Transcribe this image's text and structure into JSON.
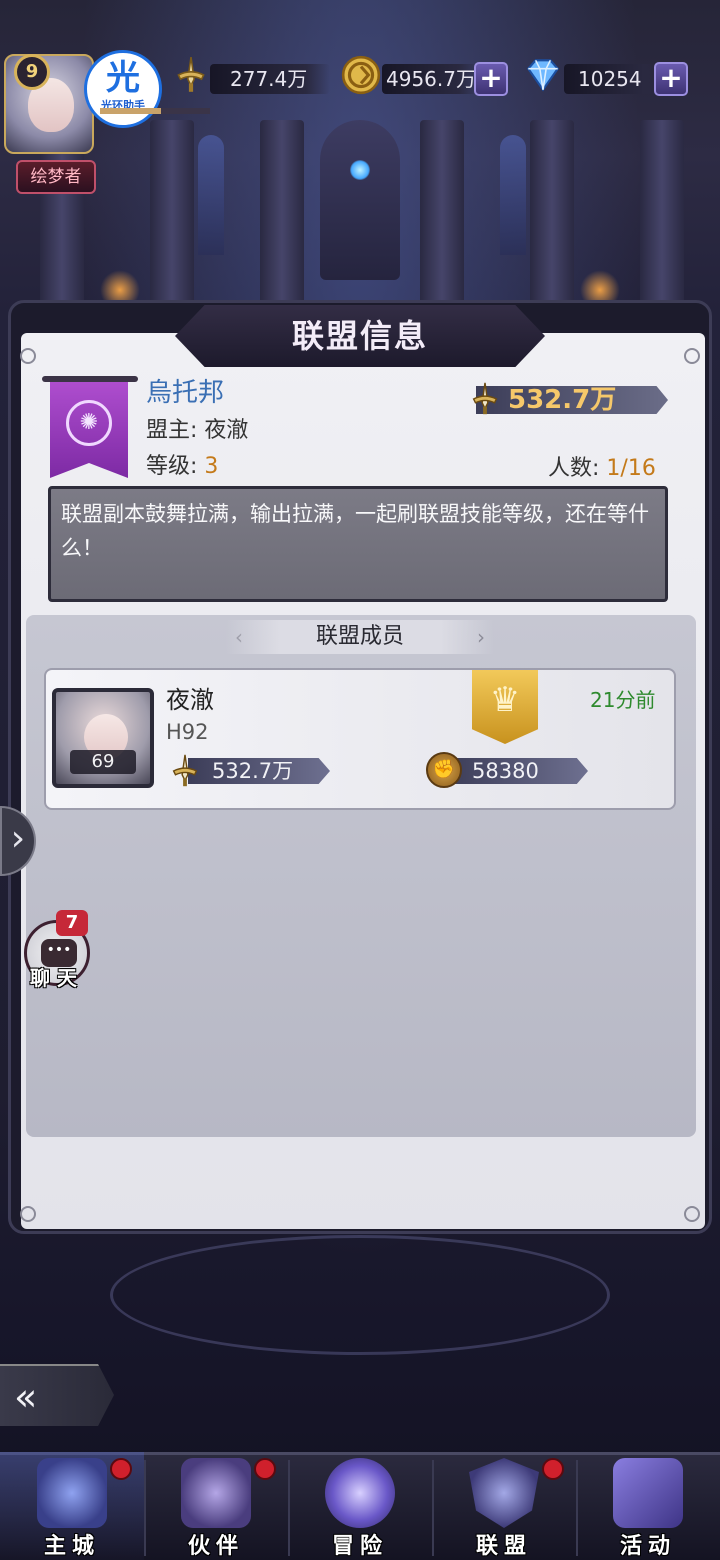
{
  "topbar": {
    "player_level": "9",
    "helper_glyph": "光",
    "helper_label": "光环助手",
    "title_badge": "绘梦者",
    "xp_fraction": 0.55,
    "resources": [
      {
        "icon": "sword-icon",
        "value": "277.4万"
      },
      {
        "icon": "gold-coin-icon",
        "value": "4956.7万"
      },
      {
        "icon": "diamond-icon",
        "value": "10254"
      }
    ],
    "plus_label": "+"
  },
  "panel": {
    "title": "联盟信息"
  },
  "alliance": {
    "name": "烏托邦",
    "leader_label": "盟主:",
    "leader_name": "夜澈",
    "level_label": "等级:",
    "level_value": "3",
    "power": "532.7万",
    "member_count_label": "人数:",
    "member_count_value": "1/16",
    "notice": "联盟副本鼓舞拉满，输出拉满，一起刷联盟技能等级，还在等什么！"
  },
  "members": {
    "header": "联盟成员",
    "list": [
      {
        "name": "夜澈",
        "server": "H92",
        "level": "69",
        "power": "532.7万",
        "contribution": "58380",
        "last_online": "21分前",
        "role_icon": "crown-icon"
      }
    ]
  },
  "side": {
    "expand_arrow": "›",
    "chat_badge": "7",
    "chat_label": "聊 天",
    "chat_bubble": "•••",
    "back_glyph": "«"
  },
  "bottom_nav": [
    {
      "label": "主城",
      "icon": "castle-icon",
      "badge": true,
      "active": true
    },
    {
      "label": "伙伴",
      "icon": "hat-icon",
      "badge": true,
      "active": false
    },
    {
      "label": "冒险",
      "icon": "portal-icon",
      "badge": false,
      "active": false
    },
    {
      "label": "联盟",
      "icon": "shield-icon",
      "badge": true,
      "active": false
    },
    {
      "label": "活动",
      "icon": "cards-icon",
      "badge": false,
      "active": false
    }
  ],
  "colors": {
    "accent_gold": "#c47a1a",
    "online_green": "#2e8a2e",
    "alliance_name_blue": "#3a6fb4",
    "badge_red": "#d0202c"
  }
}
